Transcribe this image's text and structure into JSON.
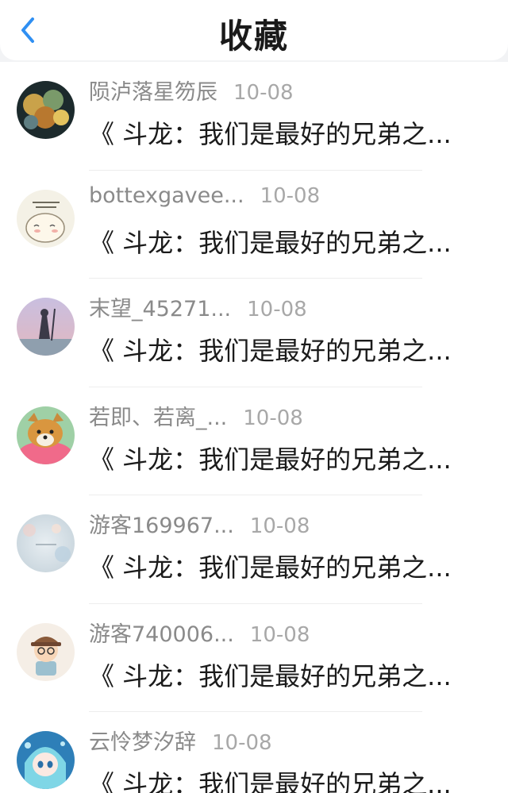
{
  "header": {
    "title": "收藏",
    "back_icon": "chevron-left-icon",
    "accent": "#2f8ff2"
  },
  "items": [
    {
      "user": "陨泸落星笏辰",
      "time": "10-08",
      "text": "《 斗龙：我们是最好的兄弟之..."
    },
    {
      "user": "bottexgavee...",
      "time": "10-08",
      "text": "《 斗龙：我们是最好的兄弟之..."
    },
    {
      "user": "末望_45271...",
      "time": "10-08",
      "text": "《 斗龙：我们是最好的兄弟之..."
    },
    {
      "user": "若即、若离_...",
      "time": "10-08",
      "text": "《 斗龙：我们是最好的兄弟之..."
    },
    {
      "user": "游客169967...",
      "time": "10-08",
      "text": "《 斗龙：我们是最好的兄弟之..."
    },
    {
      "user": "游客740006...",
      "time": "10-08",
      "text": "《 斗龙：我们是最好的兄弟之..."
    },
    {
      "user": "云怜梦汐辞",
      "time": "10-08",
      "text": "《 斗龙：我们是最好的兄弟之..."
    }
  ]
}
